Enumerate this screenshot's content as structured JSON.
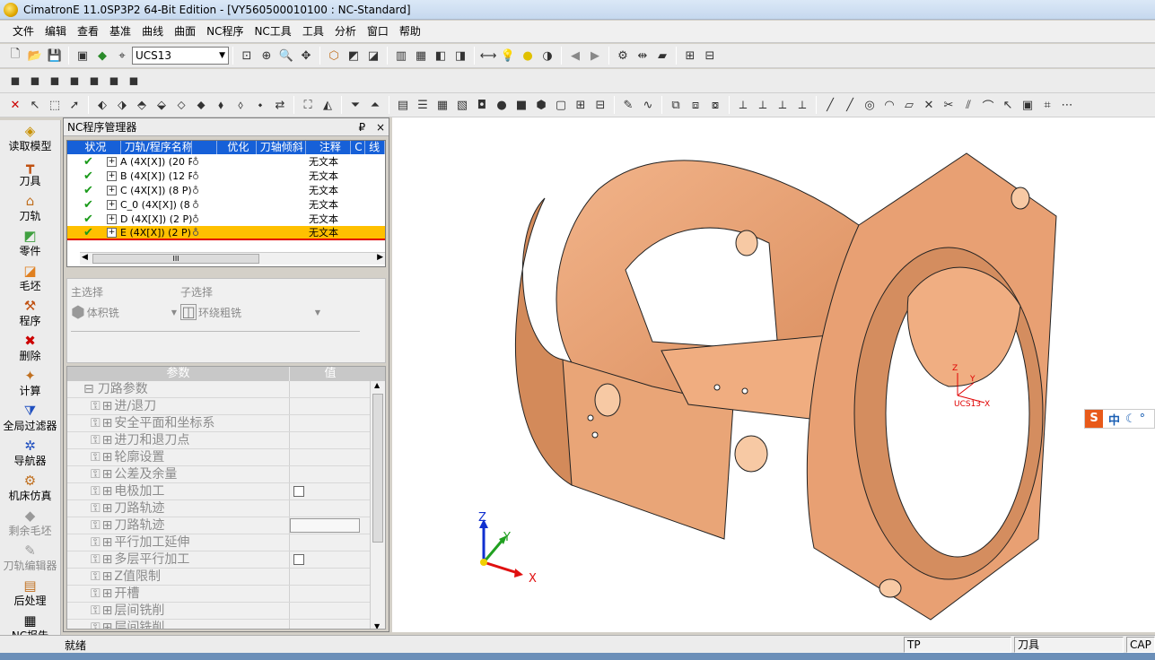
{
  "title": "CimatronE 11.0SP3P2 64-Bit Edition - [VY560500010100 : NC-Standard]",
  "menu": [
    "文件",
    "编辑",
    "查看",
    "基准",
    "曲线",
    "曲面",
    "NC程序",
    "NC工具",
    "工具",
    "分析",
    "窗口",
    "帮助"
  ],
  "ucs": "UCS13",
  "left_tools": [
    {
      "label": "读取模型",
      "icon": "load-model-icon",
      "enabled": true
    },
    {
      "label": "刀具",
      "icon": "tool-icon",
      "enabled": true
    },
    {
      "label": "刀轨",
      "icon": "toolpath-icon",
      "enabled": true
    },
    {
      "label": "零件",
      "icon": "part-icon",
      "enabled": true
    },
    {
      "label": "毛坯",
      "icon": "stock-icon",
      "enabled": true
    },
    {
      "label": "程序",
      "icon": "program-icon",
      "enabled": true
    },
    {
      "label": "删除",
      "icon": "delete-icon",
      "enabled": true
    },
    {
      "label": "计算",
      "icon": "calculate-icon",
      "enabled": true
    },
    {
      "label": "全局过滤器",
      "icon": "global-filter-icon",
      "enabled": true
    },
    {
      "label": "导航器",
      "icon": "navigator-icon",
      "enabled": true
    },
    {
      "label": "机床仿真",
      "icon": "machine-sim-icon",
      "enabled": true
    },
    {
      "label": "剩余毛坯",
      "icon": "remaining-stock-icon",
      "enabled": false
    },
    {
      "label": "刀轨编辑器",
      "icon": "toolpath-editor-icon",
      "enabled": false
    },
    {
      "label": "后处理",
      "icon": "post-process-icon",
      "enabled": true
    },
    {
      "label": "NC报告",
      "icon": "nc-report-icon",
      "enabled": true
    }
  ],
  "panel": {
    "title": "NC程序管理器",
    "pin": "₽",
    "close": "×",
    "columns": [
      "状况",
      "刀轨/程序名称",
      "",
      "优化",
      "刀轴倾斜",
      "注释",
      "C",
      "线"
    ],
    "rows": [
      {
        "name": "A (4X[X]) (20 P",
        "note": "无文本"
      },
      {
        "name": "B (4X[X]) (12 P)",
        "note": "无文本"
      },
      {
        "name": "C (4X[X]) (8 P)",
        "note": "无文本"
      },
      {
        "name": "C_0 (4X[X]) (8",
        "note": "无文本"
      },
      {
        "name": "D (4X[X]) (2 P)",
        "note": "无文本"
      },
      {
        "name": "E (4X[X]) (2 P)",
        "note": "无文本"
      }
    ],
    "scroll_thumb": "III",
    "main_select_label": "主选择",
    "sub_select_label": "子选择",
    "main_select_value": "体积铣",
    "sub_select_value": "环绕粗铣",
    "params_header": [
      "参数",
      "值"
    ],
    "params": [
      {
        "name": "刀路参数",
        "type": "group"
      },
      {
        "name": "进/退刀",
        "type": "item"
      },
      {
        "name": "安全平面和坐标系",
        "type": "item"
      },
      {
        "name": "进刀和退刀点",
        "type": "item"
      },
      {
        "name": "轮廓设置",
        "type": "item"
      },
      {
        "name": "公差及余量",
        "type": "item"
      },
      {
        "name": "电极加工",
        "type": "check"
      },
      {
        "name": "刀路轨迹",
        "type": "item"
      },
      {
        "name": "刀路轨迹",
        "type": "input"
      },
      {
        "name": "平行加工延伸",
        "type": "item"
      },
      {
        "name": "多层平行加工",
        "type": "check"
      },
      {
        "name": "Z值限制",
        "type": "item"
      },
      {
        "name": "开槽",
        "type": "item"
      },
      {
        "name": "层间铣削",
        "type": "item"
      },
      {
        "name": "层间铣削",
        "type": "item"
      }
    ]
  },
  "viewport": {
    "model_color": "#e8a478",
    "axes": {
      "x": "X",
      "y": "Y",
      "z": "Z"
    },
    "ucs_label": "UCS13"
  },
  "ime": "中",
  "status": {
    "left": "就绪",
    "mode": "TP",
    "tool": "刀具",
    "caps": "CAP"
  }
}
